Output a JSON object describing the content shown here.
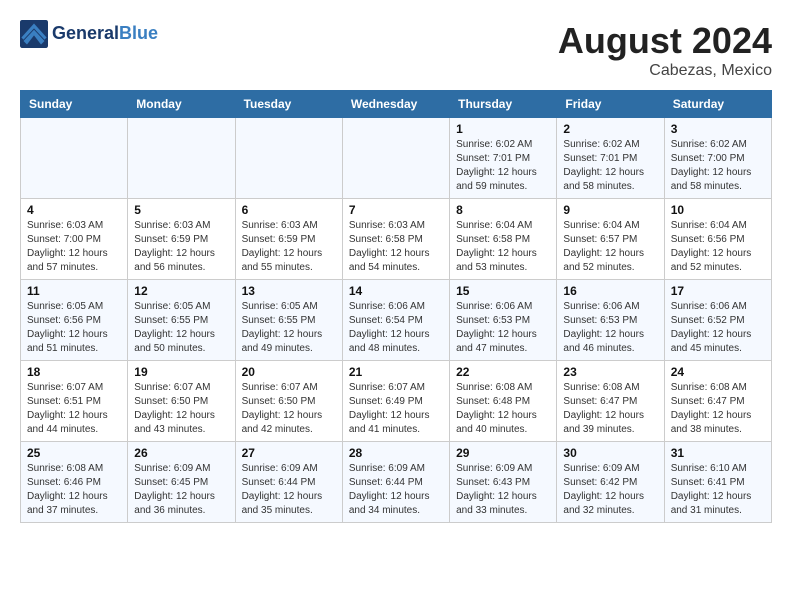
{
  "header": {
    "logo_line1": "General",
    "logo_line2": "Blue",
    "month_title": "August 2024",
    "location": "Cabezas, Mexico"
  },
  "weekdays": [
    "Sunday",
    "Monday",
    "Tuesday",
    "Wednesday",
    "Thursday",
    "Friday",
    "Saturday"
  ],
  "weeks": [
    [
      {
        "day": "",
        "info": ""
      },
      {
        "day": "",
        "info": ""
      },
      {
        "day": "",
        "info": ""
      },
      {
        "day": "",
        "info": ""
      },
      {
        "day": "1",
        "info": "Sunrise: 6:02 AM\nSunset: 7:01 PM\nDaylight: 12 hours\nand 59 minutes."
      },
      {
        "day": "2",
        "info": "Sunrise: 6:02 AM\nSunset: 7:01 PM\nDaylight: 12 hours\nand 58 minutes."
      },
      {
        "day": "3",
        "info": "Sunrise: 6:02 AM\nSunset: 7:00 PM\nDaylight: 12 hours\nand 58 minutes."
      }
    ],
    [
      {
        "day": "4",
        "info": "Sunrise: 6:03 AM\nSunset: 7:00 PM\nDaylight: 12 hours\nand 57 minutes."
      },
      {
        "day": "5",
        "info": "Sunrise: 6:03 AM\nSunset: 6:59 PM\nDaylight: 12 hours\nand 56 minutes."
      },
      {
        "day": "6",
        "info": "Sunrise: 6:03 AM\nSunset: 6:59 PM\nDaylight: 12 hours\nand 55 minutes."
      },
      {
        "day": "7",
        "info": "Sunrise: 6:03 AM\nSunset: 6:58 PM\nDaylight: 12 hours\nand 54 minutes."
      },
      {
        "day": "8",
        "info": "Sunrise: 6:04 AM\nSunset: 6:58 PM\nDaylight: 12 hours\nand 53 minutes."
      },
      {
        "day": "9",
        "info": "Sunrise: 6:04 AM\nSunset: 6:57 PM\nDaylight: 12 hours\nand 52 minutes."
      },
      {
        "day": "10",
        "info": "Sunrise: 6:04 AM\nSunset: 6:56 PM\nDaylight: 12 hours\nand 52 minutes."
      }
    ],
    [
      {
        "day": "11",
        "info": "Sunrise: 6:05 AM\nSunset: 6:56 PM\nDaylight: 12 hours\nand 51 minutes."
      },
      {
        "day": "12",
        "info": "Sunrise: 6:05 AM\nSunset: 6:55 PM\nDaylight: 12 hours\nand 50 minutes."
      },
      {
        "day": "13",
        "info": "Sunrise: 6:05 AM\nSunset: 6:55 PM\nDaylight: 12 hours\nand 49 minutes."
      },
      {
        "day": "14",
        "info": "Sunrise: 6:06 AM\nSunset: 6:54 PM\nDaylight: 12 hours\nand 48 minutes."
      },
      {
        "day": "15",
        "info": "Sunrise: 6:06 AM\nSunset: 6:53 PM\nDaylight: 12 hours\nand 47 minutes."
      },
      {
        "day": "16",
        "info": "Sunrise: 6:06 AM\nSunset: 6:53 PM\nDaylight: 12 hours\nand 46 minutes."
      },
      {
        "day": "17",
        "info": "Sunrise: 6:06 AM\nSunset: 6:52 PM\nDaylight: 12 hours\nand 45 minutes."
      }
    ],
    [
      {
        "day": "18",
        "info": "Sunrise: 6:07 AM\nSunset: 6:51 PM\nDaylight: 12 hours\nand 44 minutes."
      },
      {
        "day": "19",
        "info": "Sunrise: 6:07 AM\nSunset: 6:50 PM\nDaylight: 12 hours\nand 43 minutes."
      },
      {
        "day": "20",
        "info": "Sunrise: 6:07 AM\nSunset: 6:50 PM\nDaylight: 12 hours\nand 42 minutes."
      },
      {
        "day": "21",
        "info": "Sunrise: 6:07 AM\nSunset: 6:49 PM\nDaylight: 12 hours\nand 41 minutes."
      },
      {
        "day": "22",
        "info": "Sunrise: 6:08 AM\nSunset: 6:48 PM\nDaylight: 12 hours\nand 40 minutes."
      },
      {
        "day": "23",
        "info": "Sunrise: 6:08 AM\nSunset: 6:47 PM\nDaylight: 12 hours\nand 39 minutes."
      },
      {
        "day": "24",
        "info": "Sunrise: 6:08 AM\nSunset: 6:47 PM\nDaylight: 12 hours\nand 38 minutes."
      }
    ],
    [
      {
        "day": "25",
        "info": "Sunrise: 6:08 AM\nSunset: 6:46 PM\nDaylight: 12 hours\nand 37 minutes."
      },
      {
        "day": "26",
        "info": "Sunrise: 6:09 AM\nSunset: 6:45 PM\nDaylight: 12 hours\nand 36 minutes."
      },
      {
        "day": "27",
        "info": "Sunrise: 6:09 AM\nSunset: 6:44 PM\nDaylight: 12 hours\nand 35 minutes."
      },
      {
        "day": "28",
        "info": "Sunrise: 6:09 AM\nSunset: 6:44 PM\nDaylight: 12 hours\nand 34 minutes."
      },
      {
        "day": "29",
        "info": "Sunrise: 6:09 AM\nSunset: 6:43 PM\nDaylight: 12 hours\nand 33 minutes."
      },
      {
        "day": "30",
        "info": "Sunrise: 6:09 AM\nSunset: 6:42 PM\nDaylight: 12 hours\nand 32 minutes."
      },
      {
        "day": "31",
        "info": "Sunrise: 6:10 AM\nSunset: 6:41 PM\nDaylight: 12 hours\nand 31 minutes."
      }
    ]
  ]
}
